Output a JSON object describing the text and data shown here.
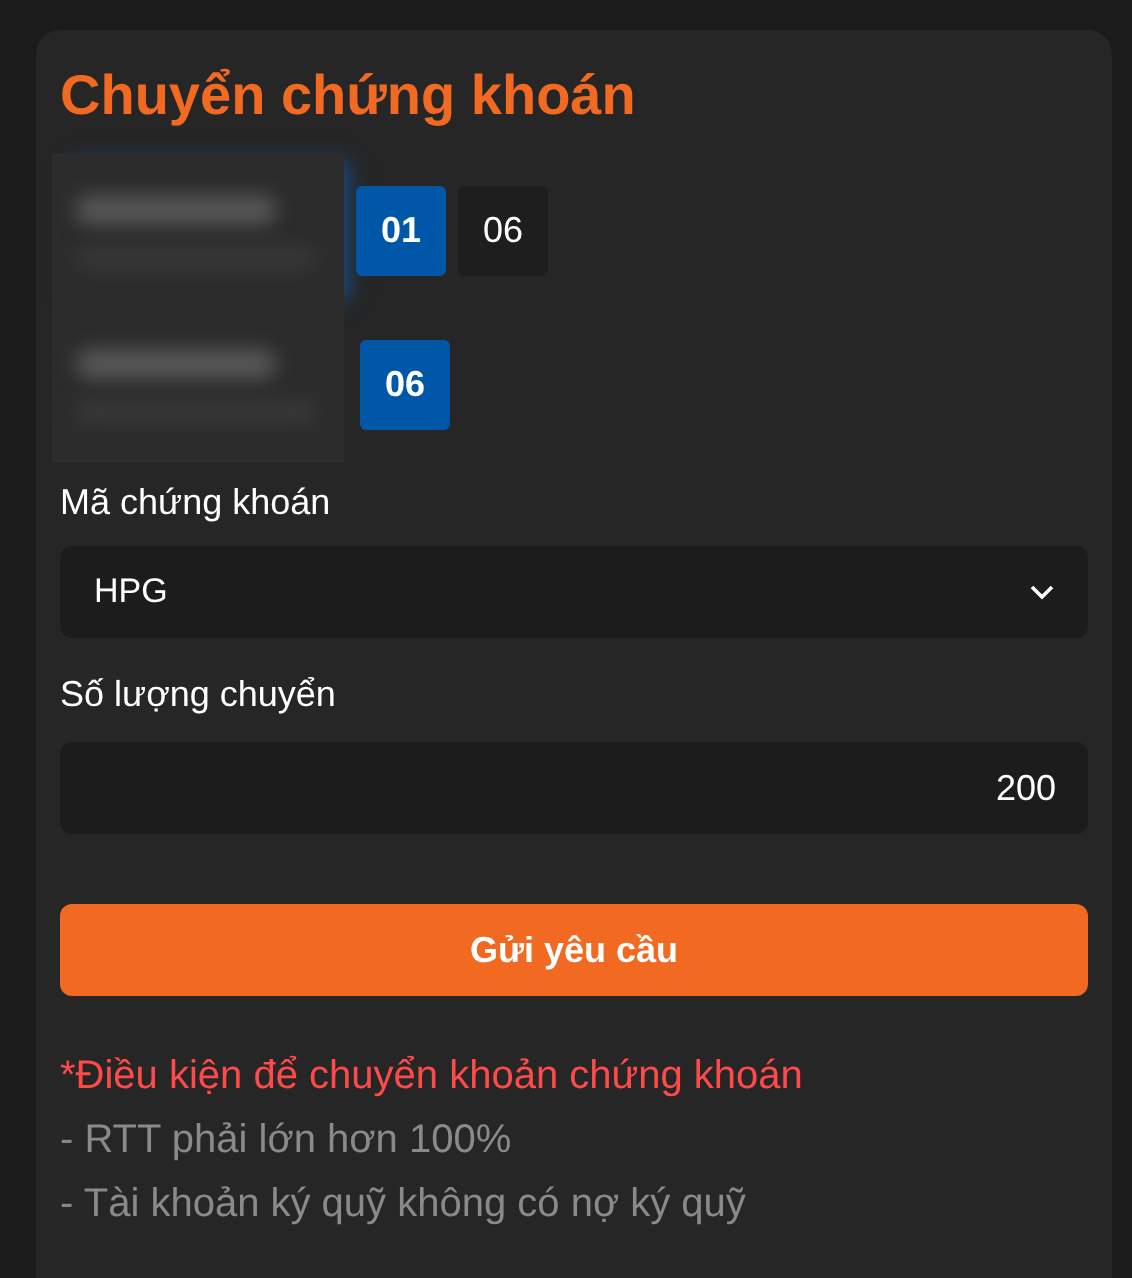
{
  "title": "Chuyển chứng khoán",
  "accounts": [
    {
      "options": [
        {
          "label": "01",
          "selected": true
        },
        {
          "label": "06",
          "selected": false
        }
      ]
    },
    {
      "options": [
        {
          "label": "06",
          "selected": true
        }
      ]
    }
  ],
  "stock_field": {
    "label": "Mã chứng khoán",
    "value": "HPG"
  },
  "quantity_field": {
    "label": "Số lượng chuyển",
    "value": "200"
  },
  "submit_button": "Gửi yêu cầu",
  "notes": {
    "heading": "*Điều kiện để chuyển khoản chứng khoán",
    "lines": [
      "- RTT phải lớn hơn 100%",
      "- Tài khoản ký quỹ không có nợ ký quỹ"
    ]
  }
}
